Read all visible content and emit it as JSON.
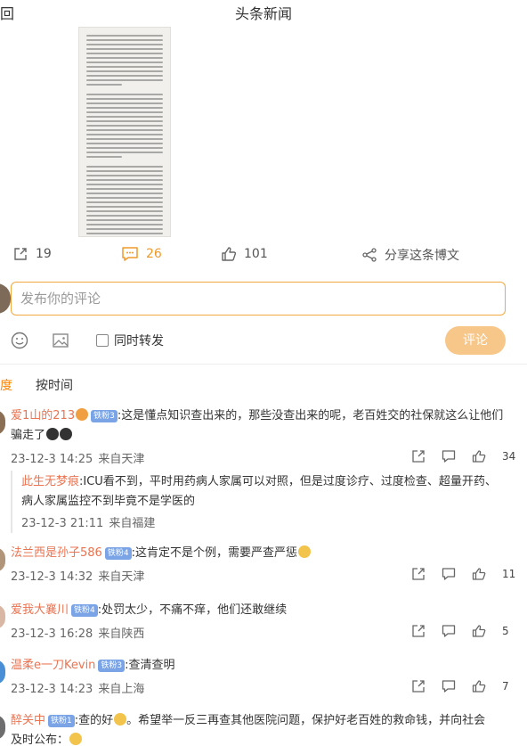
{
  "header": {
    "back_label": "返回",
    "back_visible": "回",
    "title": "头条新闻"
  },
  "post_actions": {
    "repost_count": "19",
    "comment_count": "26",
    "like_count": "101",
    "share_label": "分享这条博文"
  },
  "composer": {
    "placeholder": "发布你的评论",
    "repost_option": "同时转发",
    "submit_label": "评论"
  },
  "sort": {
    "hot_partial": "度",
    "by_time": "按时间"
  },
  "comments": [
    {
      "user": "爱1山的213",
      "badge": "铁粉3",
      "text": ":这是懂点知识查出来的，那些没查出来的呢，老百姓交的社保就这么让他们骗走了",
      "time": "23-12-3 14:25",
      "location": "来自天津",
      "likes": "34"
    },
    {
      "user": "法兰西是孙子586",
      "badge": "铁粉4",
      "text": ":这肯定不是个例，需要严查严惩",
      "time": "23-12-3 14:32",
      "location": "来自天津",
      "likes": "11"
    },
    {
      "user": "爱我大襄川",
      "badge": "铁粉4",
      "text": ":处罚太少，不痛不痒，他们还敢继续",
      "time": "23-12-3 16:28",
      "location": "来自陕西",
      "likes": "5"
    },
    {
      "user": "温柔e一刀Kevin",
      "badge": "铁粉3",
      "text": ":查清查明",
      "time": "23-12-3 14:23",
      "location": "来自上海",
      "likes": "7"
    },
    {
      "user": "醉关中",
      "badge": "铁粉1",
      "text": ":查的好",
      "text2": "。希望举一反三再查其他医院问题，保护好老百姓的救命钱，并向社会",
      "text3": "及时公布：",
      "time": "",
      "location": "",
      "likes": ""
    }
  ],
  "reply": {
    "user": "此生无梦痕",
    "text": ":ICU看不到，平时用药病人家属可以对照，但是过度诊疗、过度检查、超量开药、病人家属监控不到毕竟不是学医的",
    "time": "23-12-3 21:11",
    "location": "来自福建"
  },
  "colors": {
    "accent": "#ff8200",
    "username": "#eb7350",
    "badge": "#7aa4e6",
    "composer_border": "#f3a942",
    "submit_bg": "#f7c689"
  }
}
